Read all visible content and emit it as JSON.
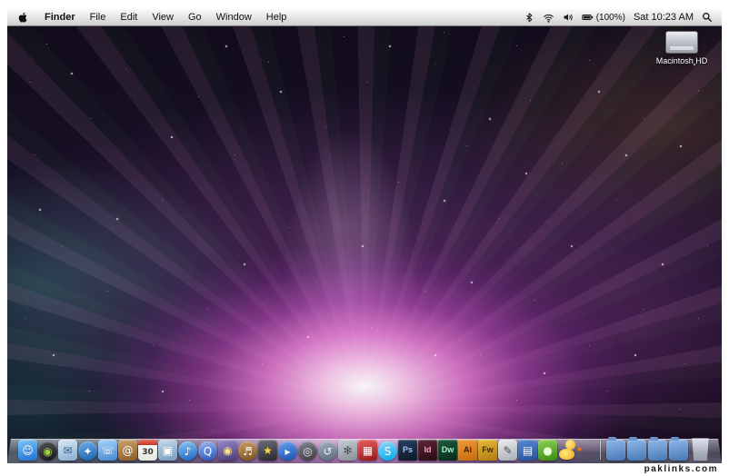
{
  "watermark": "paklinks.com",
  "colors": {
    "aurora_pink": "#f082dc",
    "aurora_purple": "#8a3aa0",
    "sky_dark": "#0b0a14",
    "menu_bar_top": "#fafafa",
    "menu_bar_bottom": "#cfcfcf"
  },
  "menu_bar": {
    "app_menu": "Finder",
    "menus": [
      "File",
      "Edit",
      "View",
      "Go",
      "Window",
      "Help"
    ],
    "status": {
      "battery": "(100%)",
      "clock": "Sat 10:23 AM"
    },
    "status_icons": [
      "bluetooth-icon",
      "wifi-icon",
      "volume-icon",
      "battery-icon",
      "spotlight-icon"
    ]
  },
  "desktop": {
    "hd_icon_label": "Macintosh HD"
  },
  "dock": {
    "left_items": [
      {
        "name": "finder",
        "glyph": "☺",
        "bg1": "#7ec8f8",
        "bg2": "#1f6fd0",
        "fg": "#ffffff"
      },
      {
        "name": "dashboard",
        "glyph": "◉",
        "bg1": "#55555e",
        "bg2": "#141418",
        "fg": "#9fd44a",
        "round": true
      },
      {
        "name": "mail",
        "glyph": "✉",
        "bg1": "#d8e8f4",
        "bg2": "#88aed0",
        "fg": "#3a6088"
      },
      {
        "name": "safari",
        "glyph": "✦",
        "bg1": "#6ab0ec",
        "bg2": "#1c5fa8",
        "fg": "#ffffff",
        "round": true
      },
      {
        "name": "ichat",
        "glyph": "☏",
        "bg1": "#a8d4f8",
        "bg2": "#4288d4",
        "fg": "#ffffff"
      },
      {
        "name": "address-book",
        "glyph": "@",
        "bg1": "#d0a470",
        "bg2": "#8a5a28",
        "fg": "#ffffff"
      },
      {
        "name": "ical",
        "type": "calendar",
        "glyph": "30",
        "fg": "#333333"
      },
      {
        "name": "preview",
        "glyph": "▣",
        "bg1": "#c4d8ec",
        "bg2": "#7a9cc0",
        "fg": "#ffffff"
      },
      {
        "name": "itunes",
        "glyph": "♪",
        "bg1": "#8ac8f6",
        "bg2": "#1a63c4",
        "fg": "#ffffff",
        "round": true
      },
      {
        "name": "quicktime",
        "glyph": "Q",
        "bg1": "#9ab8f0",
        "bg2": "#2a52b8",
        "fg": "#ffffff",
        "round": true
      },
      {
        "name": "photo-booth",
        "glyph": "◉",
        "bg1": "#9a8ac8",
        "bg2": "#4a3a78",
        "fg": "#ffe08a"
      },
      {
        "name": "garageband",
        "glyph": "♬",
        "bg1": "#cc9e5e",
        "bg2": "#7a521e",
        "fg": "#ffffff",
        "round": true
      },
      {
        "name": "imovie",
        "glyph": "★",
        "bg1": "#70707a",
        "bg2": "#26262c",
        "fg": "#ffd44a"
      },
      {
        "name": "front-row",
        "glyph": "▸",
        "bg1": "#64a2f2",
        "bg2": "#1a4fb0",
        "fg": "#ffffff",
        "round": true
      },
      {
        "name": "dvd-player",
        "glyph": "◎",
        "bg1": "#84848c",
        "bg2": "#3a3a42",
        "fg": "#e8e8f0",
        "round": true
      },
      {
        "name": "time-machine",
        "glyph": "↺",
        "bg1": "#a4b0c0",
        "bg2": "#5a6a7c",
        "fg": "#eaf2fa",
        "round": true
      },
      {
        "name": "system-preferences",
        "glyph": "✻",
        "bg1": "#c8ccd4",
        "bg2": "#8a909a",
        "fg": "#4a4e56"
      },
      {
        "name": "red-app",
        "glyph": "▦",
        "bg1": "#e86060",
        "bg2": "#9a1616",
        "fg": "#ffffff"
      },
      {
        "name": "skype",
        "glyph": "S",
        "bg1": "#8fd8fa",
        "bg2": "#00a8e8",
        "fg": "#ffffff",
        "round": true
      },
      {
        "name": "photoshop",
        "type": "adobe",
        "glyph": "Ps",
        "bg1": "#2a3f62",
        "bg2": "#0c1726",
        "fg": "#9fc8f8"
      },
      {
        "name": "indesign",
        "type": "adobe",
        "glyph": "Id",
        "bg1": "#5e2438",
        "bg2": "#2a0c16",
        "fg": "#f8a0c0"
      },
      {
        "name": "dreamweaver",
        "type": "adobe",
        "glyph": "Dw",
        "bg1": "#1e5a40",
        "bg2": "#0a2a18",
        "fg": "#9ff8c0"
      },
      {
        "name": "illustrator",
        "type": "adobe",
        "glyph": "Ai",
        "bg1": "#f09a3a",
        "bg2": "#c46a10",
        "fg": "#3a2000"
      },
      {
        "name": "fireworks",
        "type": "adobe",
        "glyph": "Fw",
        "bg1": "#e8b83a",
        "bg2": "#b07a10",
        "fg": "#3a2a00"
      },
      {
        "name": "pen-app",
        "glyph": "✎",
        "bg1": "#ecedf0",
        "bg2": "#a8acb4",
        "fg": "#4a4e56"
      },
      {
        "name": "chart-app",
        "glyph": "▤",
        "bg1": "#5a8ad4",
        "bg2": "#24509a",
        "fg": "#ffffff"
      },
      {
        "name": "adium",
        "glyph": "●",
        "bg1": "#8ed45a",
        "bg2": "#3a8a10",
        "fg": "#e8ffd0"
      },
      {
        "name": "cyberduck",
        "type": "duck",
        "glyph": ""
      }
    ],
    "right_items": [
      {
        "name": "documents-stack",
        "type": "folder",
        "glyph": ""
      },
      {
        "name": "downloads-stack",
        "type": "folder",
        "glyph": ""
      },
      {
        "name": "applications-stack",
        "type": "folder",
        "glyph": ""
      },
      {
        "name": "utilities-stack",
        "type": "folder",
        "glyph": ""
      },
      {
        "name": "trash",
        "type": "trash",
        "glyph": ""
      }
    ]
  }
}
